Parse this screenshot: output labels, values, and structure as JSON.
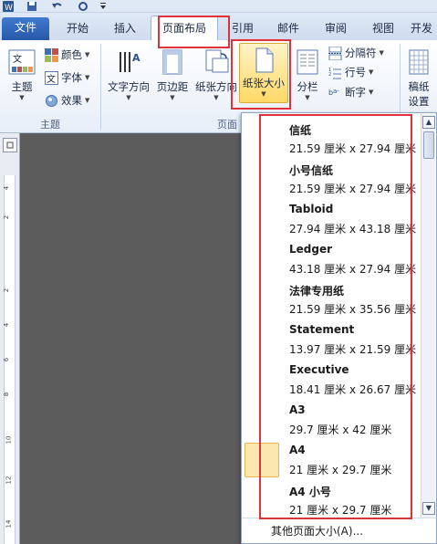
{
  "quick_access": {
    "app_icon": "word-icon",
    "save_icon": "save-icon",
    "undo_icon": "undo-icon",
    "redo_icon": "redo-icon",
    "customize_icon": "customize-arrow-icon"
  },
  "tabs": {
    "file": "文件",
    "home": "开始",
    "insert": "插入",
    "page_layout": "页面布局",
    "references": "引用",
    "mailings": "邮件",
    "review": "审阅",
    "view": "视图",
    "developer": "开发"
  },
  "ribbon": {
    "themes": "主题",
    "colors": "颜色",
    "fonts": "字体",
    "effects": "效果",
    "text_direction": "文字方向",
    "margins": "页边距",
    "orientation": "纸张方向",
    "size": "纸张大小",
    "columns": "分栏",
    "breaks": "分隔符",
    "line_numbers": "行号",
    "hyphenation": "断字",
    "manuscript_line1": "稿纸",
    "manuscript_line2": "设置",
    "group_themes": "主题",
    "group_page_setup": "页面"
  },
  "paper_sizes": [
    {
      "name": "信纸",
      "dims": "21.59 厘米 x 27.94 厘米"
    },
    {
      "name": "小号信纸",
      "dims": "21.59 厘米 x 27.94 厘米"
    },
    {
      "name": "Tabloid",
      "dims": "27.94 厘米 x 43.18 厘米"
    },
    {
      "name": "Ledger",
      "dims": "43.18 厘米 x 27.94 厘米"
    },
    {
      "name": "法律专用纸",
      "dims": "21.59 厘米 x 35.56 厘米"
    },
    {
      "name": "Statement",
      "dims": "13.97 厘米 x 21.59 厘米"
    },
    {
      "name": "Executive",
      "dims": "18.41 厘米 x 26.67 厘米"
    },
    {
      "name": "A3",
      "dims": "29.7 厘米 x 42 厘米"
    },
    {
      "name": "A4",
      "dims": "21 厘米 x 29.7 厘米"
    },
    {
      "name": "A4 小号",
      "dims": "21 厘米 x 29.7 厘米"
    }
  ],
  "selected_paper": "A4",
  "more_sizes": "其他页面大小(A)...",
  "ruler_numbers": [
    "4",
    "2",
    "2",
    "4",
    "6",
    "8",
    "10",
    "12",
    "14"
  ],
  "colors": {
    "annotation_red": "#e0323a",
    "selection_fill": "#fde7b0",
    "file_tab": "#2e63b8"
  }
}
